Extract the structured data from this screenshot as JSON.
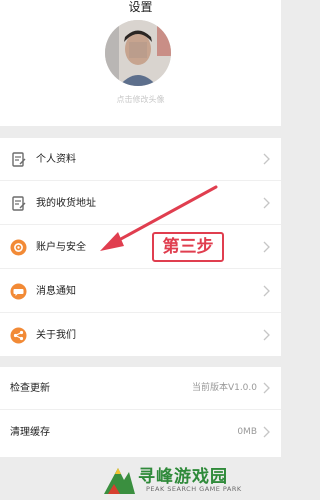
{
  "header": {
    "title": "设置",
    "avatar_caption": "点击修改头像"
  },
  "menu_group_1": [
    {
      "label": "个人资料",
      "icon": "profile-doc-icon"
    },
    {
      "label": "我的收货地址",
      "icon": "address-doc-icon"
    },
    {
      "label": "账户与安全",
      "icon": "gear-icon"
    },
    {
      "label": "消息通知",
      "icon": "message-icon"
    },
    {
      "label": "关于我们",
      "icon": "share-icon"
    }
  ],
  "menu_group_2": [
    {
      "label": "检查更新",
      "value": "当前版本V1.0.0"
    },
    {
      "label": "清理缓存",
      "value": "0MB"
    }
  ],
  "annotation": {
    "text": "第三步",
    "color": "#e03e4f"
  },
  "watermark": {
    "title": "寻峰游戏园",
    "subtitle": "PEAK SEARCH GAME PARK"
  },
  "colors": {
    "accent": "#f28a36",
    "annotation_red": "#e03e4f",
    "watermark_green": "#2f8a3a"
  }
}
